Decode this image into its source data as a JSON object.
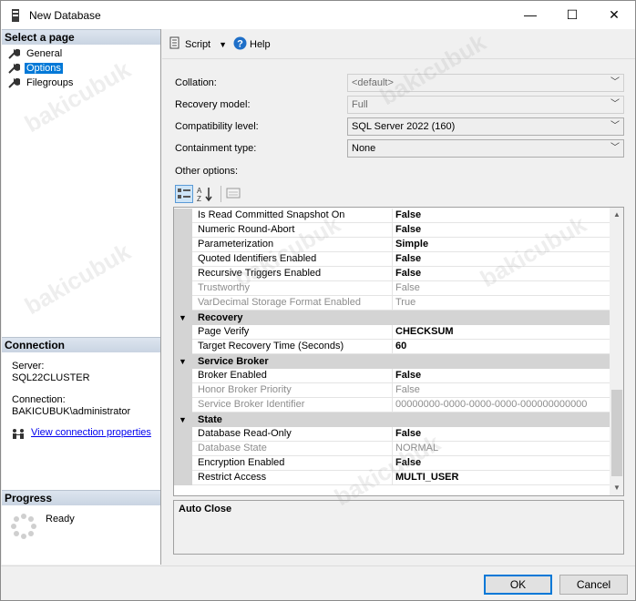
{
  "window": {
    "title": "New Database",
    "minimize_glyph": "—",
    "maximize_glyph": "☐",
    "close_glyph": "✕"
  },
  "left": {
    "select_page_header": "Select a page",
    "pages": [
      {
        "label": "General",
        "icon": "wrench-icon"
      },
      {
        "label": "Options",
        "icon": "wrench-icon",
        "selected": true
      },
      {
        "label": "Filegroups",
        "icon": "wrench-icon"
      }
    ],
    "connection_header": "Connection",
    "server_label": "Server:",
    "server_value": "SQL22CLUSTER",
    "connection_label": "Connection:",
    "connection_value": "BAKICUBUK\\administrator",
    "view_connection_link": "View connection properties",
    "progress_header": "Progress",
    "progress_status": "Ready"
  },
  "toolbar": {
    "script_label": "Script",
    "help_label": "Help"
  },
  "fields": {
    "collation_label": "Collation:",
    "collation_value": "<default>",
    "recovery_label": "Recovery model:",
    "recovery_value": "Full",
    "compat_label": "Compatibility level:",
    "compat_value": "SQL Server 2022 (160)",
    "containment_label": "Containment type:",
    "containment_value": "None",
    "other_options_label": "Other options:"
  },
  "grid": {
    "rows_top": [
      {
        "name": "Is Read Committed Snapshot On",
        "value": "False"
      },
      {
        "name": "Numeric Round-Abort",
        "value": "False"
      },
      {
        "name": "Parameterization",
        "value": "Simple"
      },
      {
        "name": "Quoted Identifiers Enabled",
        "value": "False"
      },
      {
        "name": "Recursive Triggers Enabled",
        "value": "False"
      },
      {
        "name": "Trustworthy",
        "value": "False",
        "disabled": true
      },
      {
        "name": "VarDecimal Storage Format Enabled",
        "value": "True",
        "disabled": true
      }
    ],
    "recovery_category": "Recovery",
    "recovery_rows": [
      {
        "name": "Page Verify",
        "value": "CHECKSUM"
      },
      {
        "name": "Target Recovery Time (Seconds)",
        "value": "60"
      }
    ],
    "broker_category": "Service Broker",
    "broker_rows": [
      {
        "name": "Broker Enabled",
        "value": "False"
      },
      {
        "name": "Honor Broker Priority",
        "value": "False",
        "disabled": true
      },
      {
        "name": "Service Broker Identifier",
        "value": "00000000-0000-0000-0000-000000000000",
        "disabled": true
      }
    ],
    "state_category": "State",
    "state_rows": [
      {
        "name": "Database Read-Only",
        "value": "False"
      },
      {
        "name": "Database State",
        "value": "NORMAL",
        "disabled": true
      },
      {
        "name": "Encryption Enabled",
        "value": "False"
      },
      {
        "name": "Restrict Access",
        "value": "MULTI_USER"
      }
    ]
  },
  "description": {
    "title": "Auto Close"
  },
  "buttons": {
    "ok": "OK",
    "cancel": "Cancel"
  },
  "watermark_text": "bakicubuk"
}
